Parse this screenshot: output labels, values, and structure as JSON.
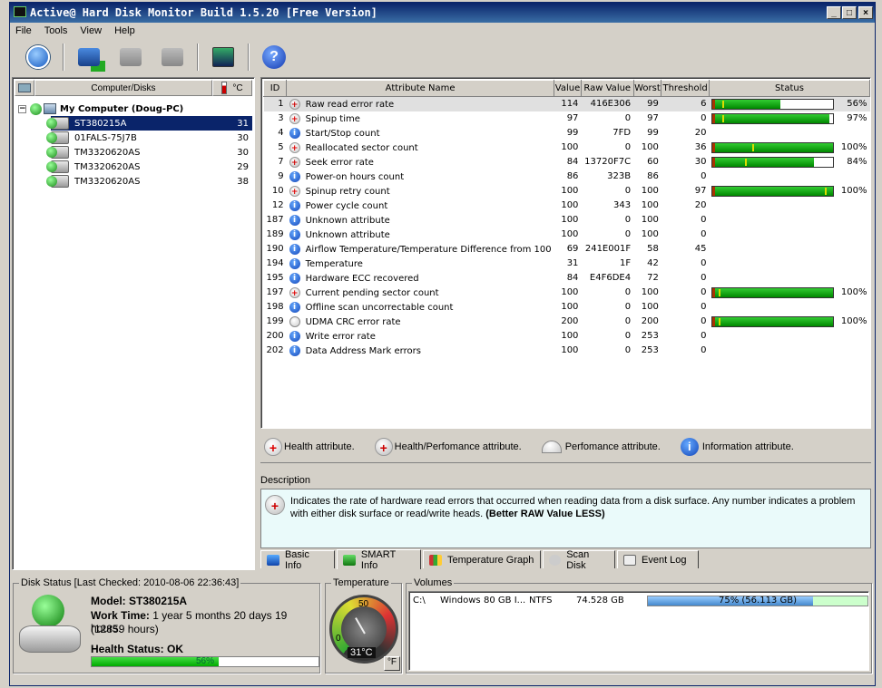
{
  "window": {
    "title": "Active@ Hard Disk Monitor Build 1.5.20 [Free Version]"
  },
  "menu": [
    "File",
    "Tools",
    "View",
    "Help"
  ],
  "tree": {
    "col_name": "Computer/Disks",
    "col_unit": "°C",
    "root": "My Computer (Doug-PC)",
    "disks": [
      {
        "name": "ST380215A",
        "temp": "31"
      },
      {
        "name": "01FALS-75J7B",
        "temp": "30"
      },
      {
        "name": "TM3320620AS",
        "temp": "30"
      },
      {
        "name": "TM3320620AS",
        "temp": "29"
      },
      {
        "name": "TM3320620AS",
        "temp": "38"
      }
    ]
  },
  "smart": {
    "headers": [
      "ID",
      "Attribute Name",
      "Value",
      "Raw Value",
      "Worst",
      "Threshold",
      "Status"
    ],
    "rows": [
      {
        "id": "1",
        "name": "Raw read error rate",
        "value": "114",
        "raw": "416E306",
        "worst": "99",
        "threshold": "6",
        "type": "hp",
        "pct": 56,
        "tick": 8,
        "pct_label": "56%"
      },
      {
        "id": "3",
        "name": "Spinup time",
        "value": "97",
        "raw": "0",
        "worst": "97",
        "threshold": "0",
        "type": "health",
        "pct": 97,
        "tick": 8,
        "pct_label": "97%"
      },
      {
        "id": "4",
        "name": "Start/Stop count",
        "value": "99",
        "raw": "7FD",
        "worst": "99",
        "threshold": "20",
        "type": "info"
      },
      {
        "id": "5",
        "name": "Reallocated sector count",
        "value": "100",
        "raw": "0",
        "worst": "100",
        "threshold": "36",
        "type": "health",
        "pct": 100,
        "tick": 33,
        "pct_label": "100%"
      },
      {
        "id": "7",
        "name": "Seek error rate",
        "value": "84",
        "raw": "13720F7C",
        "worst": "60",
        "threshold": "30",
        "type": "hp",
        "pct": 84,
        "tick": 27,
        "pct_label": "84%"
      },
      {
        "id": "9",
        "name": "Power-on hours count",
        "value": "86",
        "raw": "323B",
        "worst": "86",
        "threshold": "0",
        "type": "info"
      },
      {
        "id": "10",
        "name": "Spinup retry count",
        "value": "100",
        "raw": "0",
        "worst": "100",
        "threshold": "97",
        "type": "health",
        "pct": 100,
        "tick": 93,
        "pct_label": "100%"
      },
      {
        "id": "12",
        "name": "Power cycle count",
        "value": "100",
        "raw": "343",
        "worst": "100",
        "threshold": "20",
        "type": "info"
      },
      {
        "id": "187",
        "name": "Unknown attribute",
        "value": "100",
        "raw": "0",
        "worst": "100",
        "threshold": "0",
        "type": "info"
      },
      {
        "id": "189",
        "name": "Unknown attribute",
        "value": "100",
        "raw": "0",
        "worst": "100",
        "threshold": "0",
        "type": "info"
      },
      {
        "id": "190",
        "name": "Airflow Temperature/Temperature Difference from 100",
        "value": "69",
        "raw": "241E001F",
        "worst": "58",
        "threshold": "45",
        "type": "info"
      },
      {
        "id": "194",
        "name": "Temperature",
        "value": "31",
        "raw": "1F",
        "worst": "42",
        "threshold": "0",
        "type": "info"
      },
      {
        "id": "195",
        "name": "Hardware ECC recovered",
        "value": "84",
        "raw": "E4F6DE4",
        "worst": "72",
        "threshold": "0",
        "type": "info"
      },
      {
        "id": "197",
        "name": "Current pending sector count",
        "value": "100",
        "raw": "0",
        "worst": "100",
        "threshold": "0",
        "type": "health",
        "pct": 100,
        "tick": 5,
        "pct_label": "100%"
      },
      {
        "id": "198",
        "name": "Offline scan uncorrectable count",
        "value": "100",
        "raw": "0",
        "worst": "100",
        "threshold": "0",
        "type": "info"
      },
      {
        "id": "199",
        "name": "UDMA CRC error rate",
        "value": "200",
        "raw": "0",
        "worst": "200",
        "threshold": "0",
        "type": "perf",
        "pct": 100,
        "tick": 5,
        "pct_label": "100%"
      },
      {
        "id": "200",
        "name": "Write error rate",
        "value": "100",
        "raw": "0",
        "worst": "253",
        "threshold": "0",
        "type": "info"
      },
      {
        "id": "202",
        "name": "Data Address Mark errors",
        "value": "100",
        "raw": "0",
        "worst": "253",
        "threshold": "0",
        "type": "info"
      }
    ]
  },
  "legend": {
    "health": "Health attribute.",
    "health_perf": "Health/Perfomance attribute.",
    "perf": "Perfomance attribute.",
    "info": "Information attribute."
  },
  "description": {
    "label": "Description",
    "text": "Indicates the rate of hardware read errors that occurred when reading data from a disk surface. Any number indicates a problem with either disk surface or read/write heads.",
    "bold": "(Better RAW Value LESS)"
  },
  "tabs": [
    "Basic Info",
    "SMART Info",
    "Temperature Graph",
    "Scan Disk",
    "Event Log"
  ],
  "status": {
    "title": "Disk Status [Last Checked: 2010-08-06 22:36:43]",
    "model": "Model: ST380215A",
    "work_label": "Work Time:",
    "work_time": "1 year 5 months 20 days 19 hours.",
    "work_hours": "(12859 hours)",
    "health": "Health Status: OK",
    "health_pct": 56,
    "health_label": "56%"
  },
  "temperature": {
    "title": "Temperature",
    "scale_top": "50",
    "scale_left": "0",
    "value": "31°C",
    "unit_button": "°F"
  },
  "volumes": {
    "title": "Volumes",
    "items": [
      {
        "drive": "C:\\",
        "label": "Windows",
        "size": "80 GB I...",
        "fs": "NTFS",
        "capacity": "74.528 GB",
        "used_pct": 75,
        "used_label": "75% (56.113 GB)"
      }
    ]
  },
  "colors": {
    "bar_green": "#22aa22",
    "title_blue": "#0a246a",
    "selection": "#0a246a",
    "desc_bg": "#eafafa"
  }
}
